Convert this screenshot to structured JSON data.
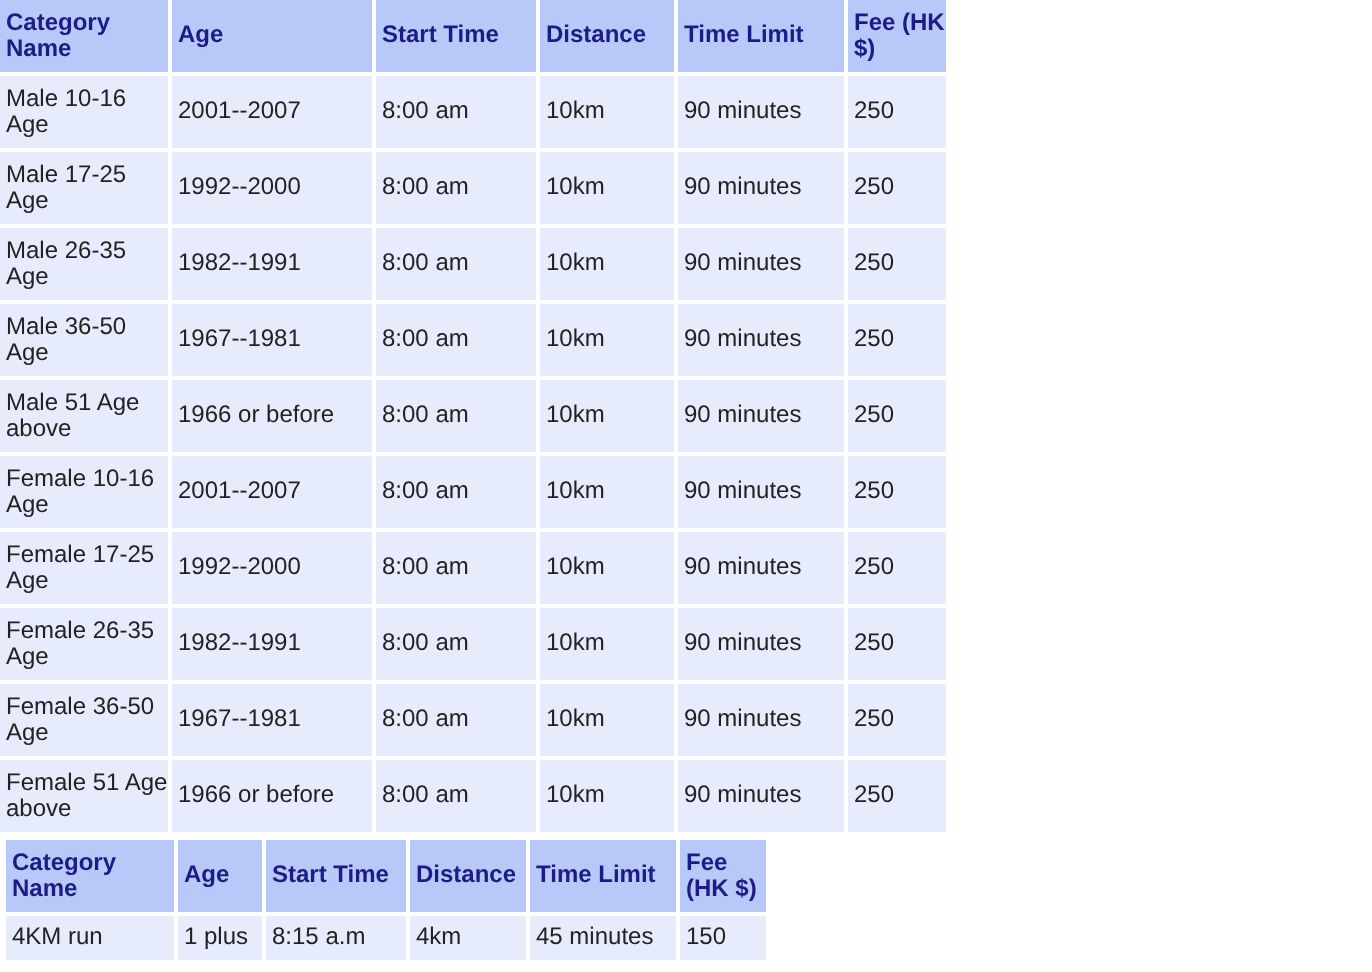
{
  "tables": [
    {
      "columns": [
        "Category Name",
        "Age",
        "Start Time",
        "Distance",
        "Time Limit",
        "Fee (HK $)"
      ],
      "rows": [
        [
          "Male 10-16 Age",
          "2001--2007",
          "8:00 am",
          "10km",
          "90 minutes",
          "250"
        ],
        [
          "Male 17-25 Age",
          "1992--2000",
          "8:00 am",
          "10km",
          "90 minutes",
          "250"
        ],
        [
          "Male 26-35 Age",
          "1982--1991",
          "8:00 am",
          "10km",
          "90 minutes",
          "250"
        ],
        [
          "Male 36-50 Age",
          "1967--1981",
          "8:00 am",
          "10km",
          "90 minutes",
          "250"
        ],
        [
          "Male 51 Age above",
          "1966 or before",
          "8:00 am",
          "10km",
          "90 minutes",
          "250"
        ],
        [
          "Female 10-16 Age",
          "2001--2007",
          "8:00 am",
          "10km",
          "90 minutes",
          "250"
        ],
        [
          "Female 17-25 Age",
          "1992--2000",
          "8:00 am",
          "10km",
          "90 minutes",
          "250"
        ],
        [
          "Female 26-35 Age",
          "1982--1991",
          "8:00 am",
          "10km",
          "90 minutes",
          "250"
        ],
        [
          "Female 36-50 Age",
          "1967--1981",
          "8:00 am",
          "10km",
          "90 minutes",
          "250"
        ],
        [
          "Female 51 Age above",
          "1966 or before",
          "8:00 am",
          "10km",
          "90 minutes",
          "250"
        ]
      ]
    },
    {
      "columns": [
        "Category Name",
        "Age",
        "Start Time",
        "Distance",
        "Time Limit",
        "Fee (HK $)"
      ],
      "rows": [
        [
          "4KM run",
          "1 plus",
          "8:15 a.m",
          "4km",
          "45 minutes",
          "150"
        ]
      ]
    }
  ]
}
